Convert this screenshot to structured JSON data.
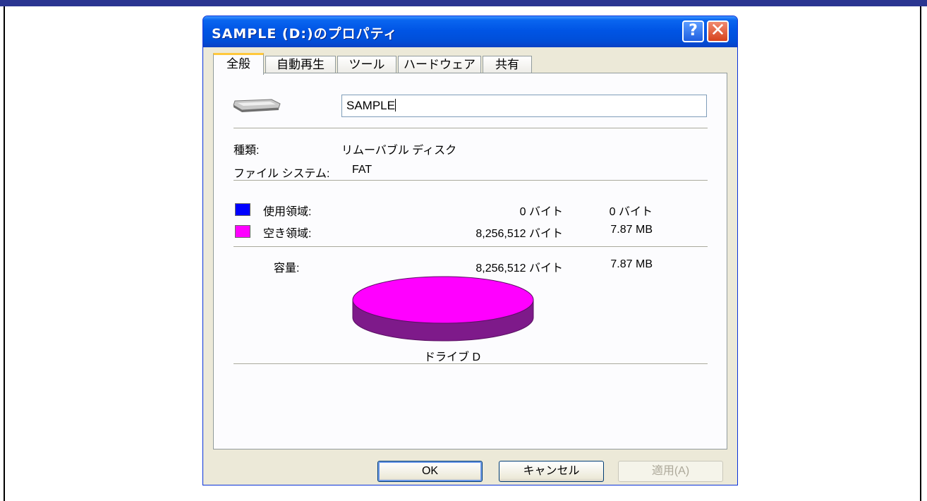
{
  "window": {
    "title": "SAMPLE (D:)のプロパティ",
    "help_glyph": "?",
    "close_glyph": "✕"
  },
  "tabs": [
    {
      "label": "全般",
      "active": true
    },
    {
      "label": "自動再生",
      "active": false
    },
    {
      "label": "ツール",
      "active": false
    },
    {
      "label": "ハードウェア",
      "active": false
    },
    {
      "label": "共有",
      "active": false
    }
  ],
  "general": {
    "drive_icon": "removable-drive-icon",
    "volume_label_value": "SAMPLE",
    "type_label": "種類:",
    "type_value": "リムーバブル ディスク",
    "fs_label": "ファイル システム:",
    "fs_value": "FAT",
    "used_label": "使用領域:",
    "used_bytes": "0 バイト",
    "used_size": "0 バイト",
    "used_color": "#0000ff",
    "free_label": "空き領域:",
    "free_bytes": "8,256,512 バイト",
    "free_size": "7.87 MB",
    "free_color": "#ff00ff",
    "capacity_label": "容量:",
    "capacity_bytes": "8,256,512 バイト",
    "capacity_size": "7.87 MB",
    "drive_caption": "ドライブ D",
    "used_fraction": 0
  },
  "buttons": {
    "ok": "OK",
    "cancel": "キャンセル",
    "apply": "適用(A)"
  }
}
